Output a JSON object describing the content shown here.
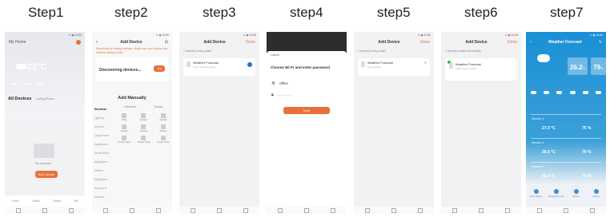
{
  "steps": [
    "Step1",
    "step2",
    "step3",
    "step4",
    "step5",
    "step6",
    "step7"
  ],
  "phone1": {
    "home_title": "My Home",
    "temperature": "22°C",
    "tab_all": "All Devices",
    "tab_living": "Living Room",
    "no_devices": "No devices",
    "add_device": "Add Device",
    "nav": [
      "Home",
      "Smart",
      "Scene",
      "Me"
    ]
  },
  "phone2": {
    "title": "Add Device",
    "info": "Searching for nearby devices. Make sure your device has entered pairing mode.",
    "discovering": "Discovering devices...",
    "go": "Go",
    "add_manually": "Add Manually",
    "categories": [
      "Electrical",
      "Lighting",
      "Sensors",
      "Large Home Appliances",
      "Small Home Appliances",
      "Kitchen Appliances",
      "Security & Sensors"
    ],
    "section_tab_a": "Electrical",
    "section_tab_b": "Socket",
    "items": [
      "Plug",
      "Socket",
      "Socket",
      "Socket",
      "Socket",
      "Socket",
      "Power Strip",
      "Power Strip",
      "Power Strip"
    ]
  },
  "phone3": {
    "title": "Add Device",
    "done": "Done",
    "sub": "1 device(s) being added",
    "device": "Weather Forecast",
    "device_sub": "Tap to add the device"
  },
  "phone4": {
    "cancel": "Cancel",
    "heading": "Choose Wi-Fi and enter password",
    "wifi": "office",
    "password": "·········",
    "next": "Next"
  },
  "phone5": {
    "title": "Add Device",
    "done": "Done",
    "sub": "1 device(s) being added",
    "device": "Weather Forecast",
    "device_sub": "Being Added"
  },
  "phone6": {
    "title": "Add Device",
    "done": "Done",
    "sub": "1 device(s) added successfully",
    "device": "Weather Forecast",
    "device_sub": "Added successfully"
  },
  "phone7": {
    "title": "Weather Forecast",
    "main_temp": "26.2",
    "main_temp_unit": "°c",
    "main_hum": "79",
    "main_hum_unit": "%",
    "rows": [
      {
        "device": "Device 1",
        "temp": "27.0 °C",
        "hum": "75 %"
      },
      {
        "device": "Device 2",
        "temp": "26.6 °C",
        "hum": "79 %"
      },
      {
        "device": "Device 3",
        "temp": "25.3 °C",
        "hum": "75 %"
      }
    ],
    "bottom": [
      "Alarm Setting",
      "Temperature Unit",
      "Device",
      "Setting"
    ]
  }
}
